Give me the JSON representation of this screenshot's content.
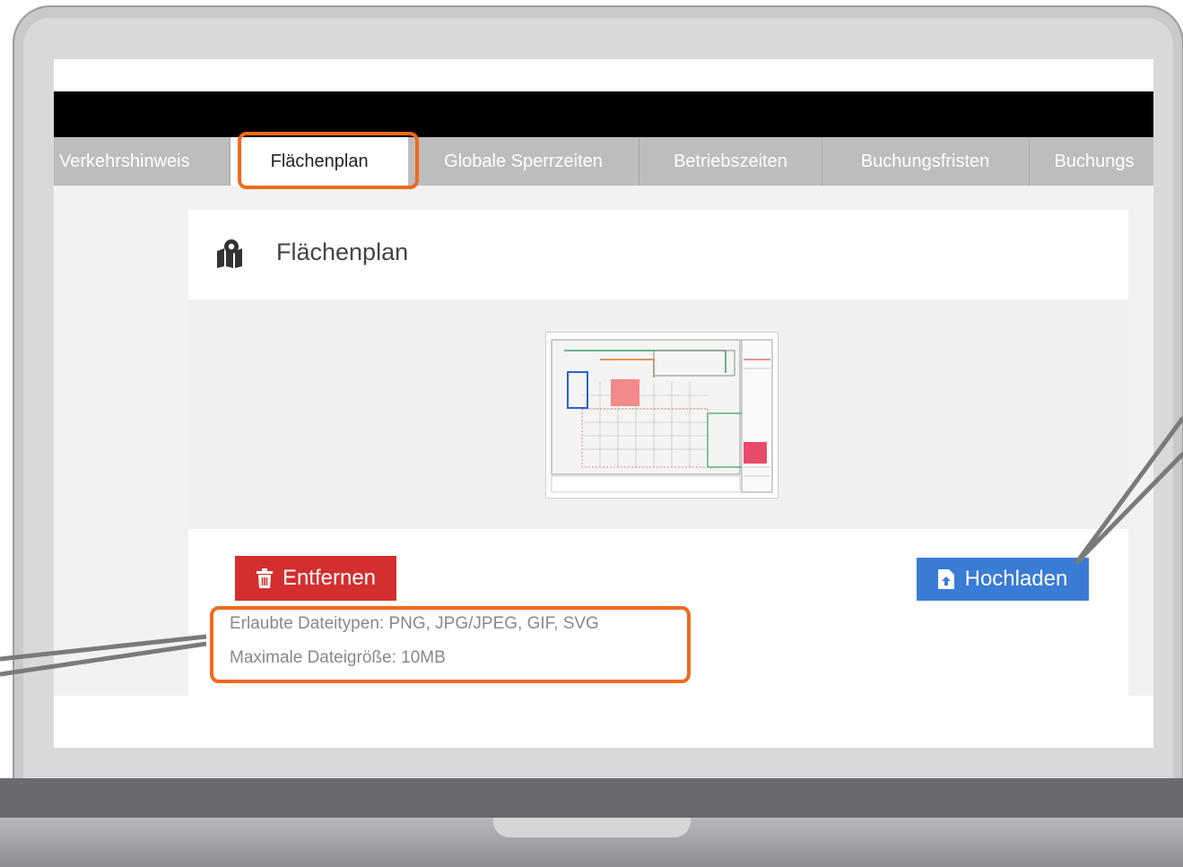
{
  "tabs": [
    {
      "label": "Verkehrshinweis"
    },
    {
      "label": "Flächenplan",
      "active": true
    },
    {
      "label": "Globale Sperrzeiten"
    },
    {
      "label": "Betriebszeiten"
    },
    {
      "label": "Buchungsfristen"
    },
    {
      "label": "Buchungs"
    }
  ],
  "panel": {
    "title": "Flächenplan",
    "icon": "map-marker-icon"
  },
  "actions": {
    "remove_label": "Entfernen",
    "remove_icon": "trash-icon",
    "upload_label": "Hochladen",
    "upload_icon": "file-upload-icon"
  },
  "hints": {
    "allowed_types": "Erlaubte Dateitypen: PNG, JPG/JPEG, GIF, SVG",
    "max_size": "Maximale Dateigröße: 10MB"
  },
  "colors": {
    "highlight": "#ef6a1d",
    "remove_button": "#d32f2f",
    "upload_button": "#3a7bd5",
    "tab_bar": "#bdbdbd"
  }
}
